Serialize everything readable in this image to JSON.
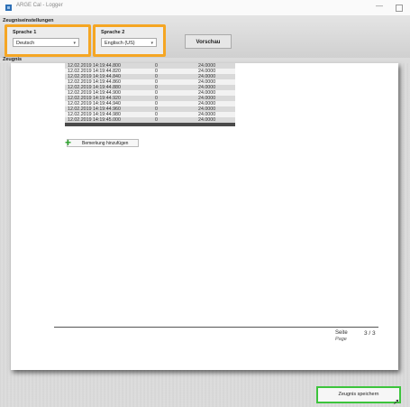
{
  "window": {
    "title": "ARGE Cal - Logger",
    "minimize_glyph": "—"
  },
  "settings": {
    "section_title": "Zeugniseinstellungen",
    "lang1": {
      "label": "Sprache 1",
      "value": "Deutsch"
    },
    "lang2": {
      "label": "Sprache 2",
      "value": "Englisch (US)"
    },
    "preview_label": "Vorschau",
    "highlight_color": "#f5a623"
  },
  "zeugnis": {
    "section_title": "Zeugnis",
    "rows": [
      [
        "12.02.2019 14:19:44.800",
        "0",
        "24.0000"
      ],
      [
        "12.02.2019 14:19:44.820",
        "0",
        "24.0000"
      ],
      [
        "12.02.2019 14:19:44.840",
        "0",
        "24.0000"
      ],
      [
        "12.02.2019 14:19:44.860",
        "0",
        "24.0000"
      ],
      [
        "12.02.2019 14:19:44.880",
        "0",
        "24.0000"
      ],
      [
        "12.02.2019 14:19:44.900",
        "0",
        "24.0000"
      ],
      [
        "12.02.2019 14:19:44.920",
        "0",
        "24.0000"
      ],
      [
        "12.02.2019 14:19:44.940",
        "0",
        "24.0000"
      ],
      [
        "12.02.2019 14:19:44.960",
        "0",
        "24.0000"
      ],
      [
        "12.02.2019 14:19:44.980",
        "0",
        "24.0000"
      ],
      [
        "12.02.2019 14:19:45.000",
        "0",
        "24.0000"
      ]
    ],
    "remark_button": "Bemerkung hinzufügen",
    "page_label": "Seite",
    "page_label_en": "Page",
    "page_number": "3 / 3"
  },
  "save_button": "Zeugnis speichern",
  "save_highlight_color": "#3cc43c"
}
